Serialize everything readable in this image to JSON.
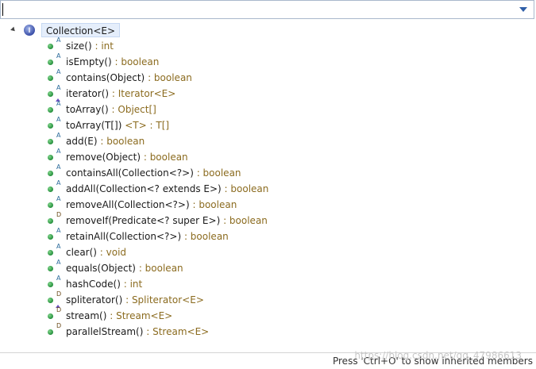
{
  "filter": {
    "value": "",
    "placeholder": ""
  },
  "root": {
    "icon": "interface-icon",
    "icon_letter": "I",
    "label": "Collection<E>"
  },
  "members": [
    {
      "mod": "A",
      "name": "size()",
      "ret": " : int"
    },
    {
      "mod": "A",
      "name": "isEmpty()",
      "ret": " : boolean"
    },
    {
      "mod": "A",
      "name": "contains(Object)",
      "ret": " : boolean"
    },
    {
      "mod": "A",
      "name": "iterator()",
      "ret": " : Iterator<E>",
      "sync": true
    },
    {
      "mod": "A",
      "name": "toArray()",
      "ret": " : Object[]"
    },
    {
      "mod": "A",
      "name": "toArray(T[])",
      "ret": " <T> : T[]"
    },
    {
      "mod": "A",
      "name": "add(E)",
      "ret": " : boolean"
    },
    {
      "mod": "A",
      "name": "remove(Object)",
      "ret": " : boolean"
    },
    {
      "mod": "A",
      "name": "containsAll(Collection<?>)",
      "ret": " : boolean"
    },
    {
      "mod": "A",
      "name": "addAll(Collection<? extends E>)",
      "ret": " : boolean"
    },
    {
      "mod": "A",
      "name": "removeAll(Collection<?>)",
      "ret": " : boolean"
    },
    {
      "mod": "D",
      "name": "removeIf(Predicate<? super E>)",
      "ret": " : boolean"
    },
    {
      "mod": "A",
      "name": "retainAll(Collection<?>)",
      "ret": " : boolean"
    },
    {
      "mod": "A",
      "name": "clear()",
      "ret": " : void"
    },
    {
      "mod": "A",
      "name": "equals(Object)",
      "ret": " : boolean"
    },
    {
      "mod": "A",
      "name": "hashCode()",
      "ret": " : int"
    },
    {
      "mod": "D",
      "name": "spliterator()",
      "ret": " : Spliterator<E>",
      "sync": true
    },
    {
      "mod": "D",
      "name": "stream()",
      "ret": " : Stream<E>"
    },
    {
      "mod": "D",
      "name": "parallelStream()",
      "ret": " : Stream<E>"
    }
  ],
  "status": {
    "hint": "Press 'Ctrl+O' to show inherited members"
  },
  "watermark": "https://blog.csdn.net/qq_47986613"
}
